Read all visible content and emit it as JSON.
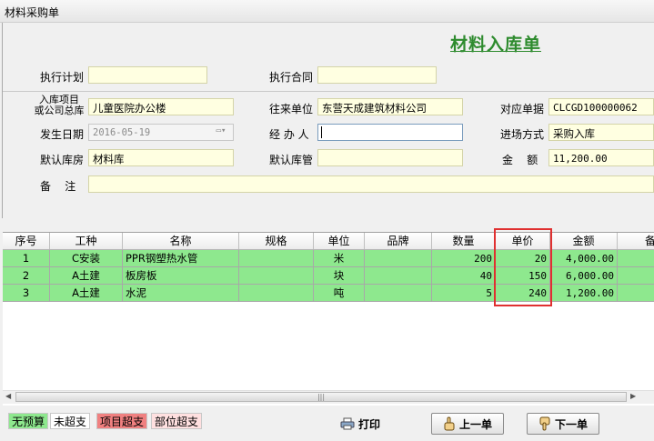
{
  "window": {
    "title": "材料采购单"
  },
  "form": {
    "title": "材料入库单"
  },
  "labels": {
    "plan": "执行计划",
    "contract": "执行合同",
    "project_line1": "入库项目",
    "project_line2": "或公司总库",
    "supplier": "往来单位",
    "ref_doc": "对应单据",
    "date": "发生日期",
    "handler": "经 办 人",
    "method": "进场方式",
    "warehouse": "默认库房",
    "keeper": "默认库管",
    "amount": "金    额",
    "remark": "备    注"
  },
  "values": {
    "plan": "",
    "contract": "",
    "project": "儿童医院办公楼",
    "supplier": "东营天成建筑材料公司",
    "ref_doc": "CLCGD100000062",
    "date": "2016-05-19",
    "handler": "",
    "method": "采购入库",
    "warehouse": "材料库",
    "keeper": "",
    "amount": "11,200.00",
    "remark": ""
  },
  "table": {
    "headers": [
      "序号",
      "工种",
      "名称",
      "规格",
      "单位",
      "品牌",
      "数量",
      "单价",
      "金额",
      "备"
    ],
    "rows": [
      [
        "1",
        "C安装",
        "PPR钢塑热水管",
        "",
        "米",
        "",
        "200",
        "20",
        "4,000.00"
      ],
      [
        "2",
        "A土建",
        "板房板",
        "",
        "块",
        "",
        "40",
        "150",
        "6,000.00"
      ],
      [
        "3",
        "A土建",
        "水泥",
        "",
        "吨",
        "",
        "5",
        "240",
        "1,200.00"
      ]
    ],
    "row_color": "#8ee88e"
  },
  "legend": {
    "no_budget": "无预算",
    "not_over": "未超支",
    "project_over": "项目超支",
    "dept_over": "部位超支",
    "colors": {
      "no_budget": "#8ee88e",
      "not_over": "#ffffff",
      "project_over": "#f08080",
      "dept_over": "#ffe0e0"
    }
  },
  "buttons": {
    "print": "打印",
    "prev": "上一单",
    "next": "下一单"
  },
  "icons": {
    "print": "printer-icon",
    "prev": "hand-up-icon",
    "next": "hand-down-icon",
    "date": "calendar-dropdown-icon"
  },
  "accent": {
    "title_color": "#2e8b2e",
    "highlight": "#e03030"
  }
}
